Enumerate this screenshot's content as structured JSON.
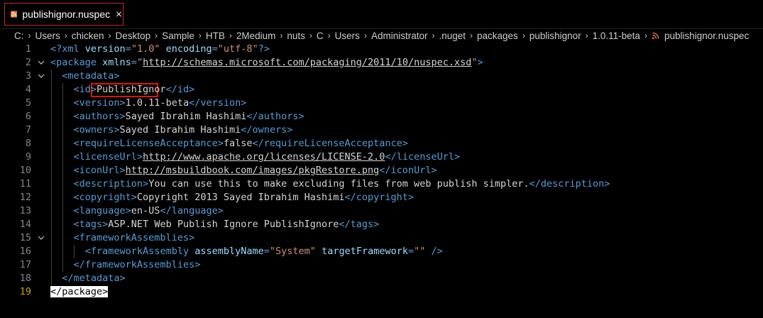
{
  "tab": {
    "filename": "publishignor.nuspec"
  },
  "breadcrumbs": [
    "C:",
    "Users",
    "chicken",
    "Desktop",
    "Sample",
    "HTB",
    "2Medium",
    "nuts",
    "C",
    "Users",
    "Administrator",
    ".nuget",
    "packages",
    "publishignor",
    "1.0.11-beta"
  ],
  "breadcrumb_file": "publishignor.nuspec",
  "lines": [
    {
      "n": "1",
      "parts": [
        [
          "tag",
          "<?xml "
        ],
        [
          "attr",
          "version"
        ],
        [
          "tag",
          "="
        ],
        [
          "str",
          "\"1.0\""
        ],
        [
          "tag",
          " "
        ],
        [
          "attr",
          "encoding"
        ],
        [
          "tag",
          "="
        ],
        [
          "str",
          "\"utf-8\""
        ],
        [
          "tag",
          "?>"
        ]
      ]
    },
    {
      "n": "2",
      "parts": [
        [
          "tag",
          "<package "
        ],
        [
          "attr",
          "xmlns"
        ],
        [
          "tag",
          "="
        ],
        [
          "str",
          "\""
        ],
        [
          "strlink",
          "http://schemas.microsoft.com/packaging/2011/10/nuspec.xsd"
        ],
        [
          "str",
          "\""
        ],
        [
          "tag",
          ">"
        ]
      ]
    },
    {
      "n": "3",
      "parts": [
        [
          "txt",
          "  "
        ],
        [
          "tag",
          "<metadata>"
        ]
      ]
    },
    {
      "n": "4",
      "parts": [
        [
          "txt",
          "    "
        ],
        [
          "tag",
          "<id>"
        ],
        [
          "txt",
          "PublishIgnor"
        ],
        [
          "tag",
          "</id>"
        ]
      ]
    },
    {
      "n": "5",
      "parts": [
        [
          "txt",
          "    "
        ],
        [
          "tag",
          "<version>"
        ],
        [
          "txt",
          "1.0.11-beta"
        ],
        [
          "tag",
          "</version>"
        ]
      ]
    },
    {
      "n": "6",
      "parts": [
        [
          "txt",
          "    "
        ],
        [
          "tag",
          "<authors>"
        ],
        [
          "txt",
          "Sayed Ibrahim Hashimi"
        ],
        [
          "tag",
          "</authors>"
        ]
      ]
    },
    {
      "n": "7",
      "parts": [
        [
          "txt",
          "    "
        ],
        [
          "tag",
          "<owners>"
        ],
        [
          "txt",
          "Sayed Ibrahim Hashimi"
        ],
        [
          "tag",
          "</owners>"
        ]
      ]
    },
    {
      "n": "8",
      "parts": [
        [
          "txt",
          "    "
        ],
        [
          "tag",
          "<requireLicenseAcceptance>"
        ],
        [
          "txt",
          "false"
        ],
        [
          "tag",
          "</requireLicenseAcceptance>"
        ]
      ]
    },
    {
      "n": "9",
      "parts": [
        [
          "txt",
          "    "
        ],
        [
          "tag",
          "<licenseUrl>"
        ],
        [
          "link",
          "http://www.apache.org/licenses/LICENSE-2.0"
        ],
        [
          "tag",
          "</licenseUrl>"
        ]
      ]
    },
    {
      "n": "10",
      "parts": [
        [
          "txt",
          "    "
        ],
        [
          "tag",
          "<iconUrl>"
        ],
        [
          "link",
          "http://msbuildbook.com/images/pkgRestore.png"
        ],
        [
          "tag",
          "</iconUrl>"
        ]
      ]
    },
    {
      "n": "11",
      "parts": [
        [
          "txt",
          "    "
        ],
        [
          "tag",
          "<description>"
        ],
        [
          "txt",
          "You can use this to make excluding files from web publish simpler."
        ],
        [
          "tag",
          "</description>"
        ]
      ]
    },
    {
      "n": "12",
      "parts": [
        [
          "txt",
          "    "
        ],
        [
          "tag",
          "<copyright>"
        ],
        [
          "txt",
          "Copyright 2013 Sayed Ibrahim Hashimi"
        ],
        [
          "tag",
          "</copyright>"
        ]
      ]
    },
    {
      "n": "13",
      "parts": [
        [
          "txt",
          "    "
        ],
        [
          "tag",
          "<language>"
        ],
        [
          "txt",
          "en-US"
        ],
        [
          "tag",
          "</language>"
        ]
      ]
    },
    {
      "n": "14",
      "parts": [
        [
          "txt",
          "    "
        ],
        [
          "tag",
          "<tags>"
        ],
        [
          "txt",
          "ASP.NET Web Publish Ignore PublishIgnore"
        ],
        [
          "tag",
          "</tags>"
        ]
      ]
    },
    {
      "n": "15",
      "parts": [
        [
          "txt",
          "    "
        ],
        [
          "tag",
          "<frameworkAssemblies>"
        ]
      ]
    },
    {
      "n": "16",
      "parts": [
        [
          "txt",
          "      "
        ],
        [
          "tag",
          "<frameworkAssembly "
        ],
        [
          "attr",
          "assemblyName"
        ],
        [
          "tag",
          "="
        ],
        [
          "str",
          "\"System\""
        ],
        [
          "tag",
          " "
        ],
        [
          "attr",
          "targetFramework"
        ],
        [
          "tag",
          "="
        ],
        [
          "str",
          "\"\""
        ],
        [
          "tag",
          " />"
        ]
      ]
    },
    {
      "n": "17",
      "parts": [
        [
          "txt",
          "    "
        ],
        [
          "tag",
          "</frameworkAssemblies>"
        ]
      ]
    },
    {
      "n": "18",
      "parts": [
        [
          "txt",
          "  "
        ],
        [
          "tag",
          "</metadata>"
        ]
      ]
    },
    {
      "n": "19",
      "parts": [
        [
          "cursor",
          "</package>"
        ]
      ]
    }
  ],
  "active_line": "19",
  "fold_lines": [
    "2",
    "3",
    "15"
  ],
  "colors": {
    "tag": "#569cd6",
    "attr": "#9cdcfe",
    "string": "#ce9178",
    "text": "#d4d4d4",
    "line_number": "#858585",
    "active_line_number": "#c6a700",
    "highlight_box": "#e51400"
  }
}
